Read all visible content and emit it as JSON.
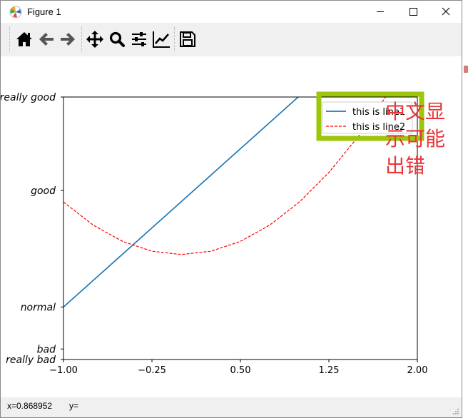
{
  "window": {
    "title": "Figure 1"
  },
  "toolbar": {
    "buttons": [
      {
        "name": "home",
        "icon": "home-icon"
      },
      {
        "name": "back",
        "icon": "arrow-left-icon"
      },
      {
        "name": "forward",
        "icon": "arrow-right-icon"
      },
      {
        "name": "pan",
        "icon": "move-icon"
      },
      {
        "name": "zoom",
        "icon": "magnifier-icon"
      },
      {
        "name": "configure-subplots",
        "icon": "sliders-icon"
      },
      {
        "name": "edit-axis",
        "icon": "line-chart-icon"
      },
      {
        "name": "save",
        "icon": "floppy-disk-icon"
      }
    ]
  },
  "status": {
    "x": "x=0.868952",
    "y": "y="
  },
  "annotation": {
    "lines": [
      "中文显",
      "示可能",
      "出错"
    ],
    "color": "#e8363a"
  },
  "chart_data": {
    "type": "line",
    "title": "",
    "xlabel": "",
    "ylabel": "",
    "xlim": [
      -1,
      2
    ],
    "ylim": [
      -2,
      3
    ],
    "x_ticks": [
      -1.0,
      -0.25,
      0.5,
      1.25,
      2.0
    ],
    "x_tick_labels": [
      "−1.00",
      "−0.25",
      "0.50",
      "1.25",
      "2.00"
    ],
    "y_ticks": [
      -2,
      -1.8,
      -1,
      1.22,
      3
    ],
    "y_tick_labels": [
      "really bad",
      "bad",
      "normal",
      "good",
      "really good"
    ],
    "series": [
      {
        "name": "this is line1",
        "color": "#1f77b4",
        "style": "solid",
        "x": [
          -1,
          0.99
        ],
        "y": [
          -1,
          3
        ]
      },
      {
        "name": "this is line2",
        "color": "#ff0000",
        "style": "dashed",
        "x": [
          -1,
          -0.75,
          -0.5,
          -0.25,
          0,
          0.25,
          0.5,
          0.75,
          1.0,
          1.25,
          1.5,
          1.75
        ],
        "y": [
          1.0,
          0.5625,
          0.25,
          0.0625,
          0,
          0.0625,
          0.25,
          0.5625,
          1.0,
          1.5625,
          2.25,
          3.0625
        ]
      }
    ],
    "legend": {
      "position": "top-right",
      "highlight_color": "#9dc50a"
    },
    "grid": false
  }
}
